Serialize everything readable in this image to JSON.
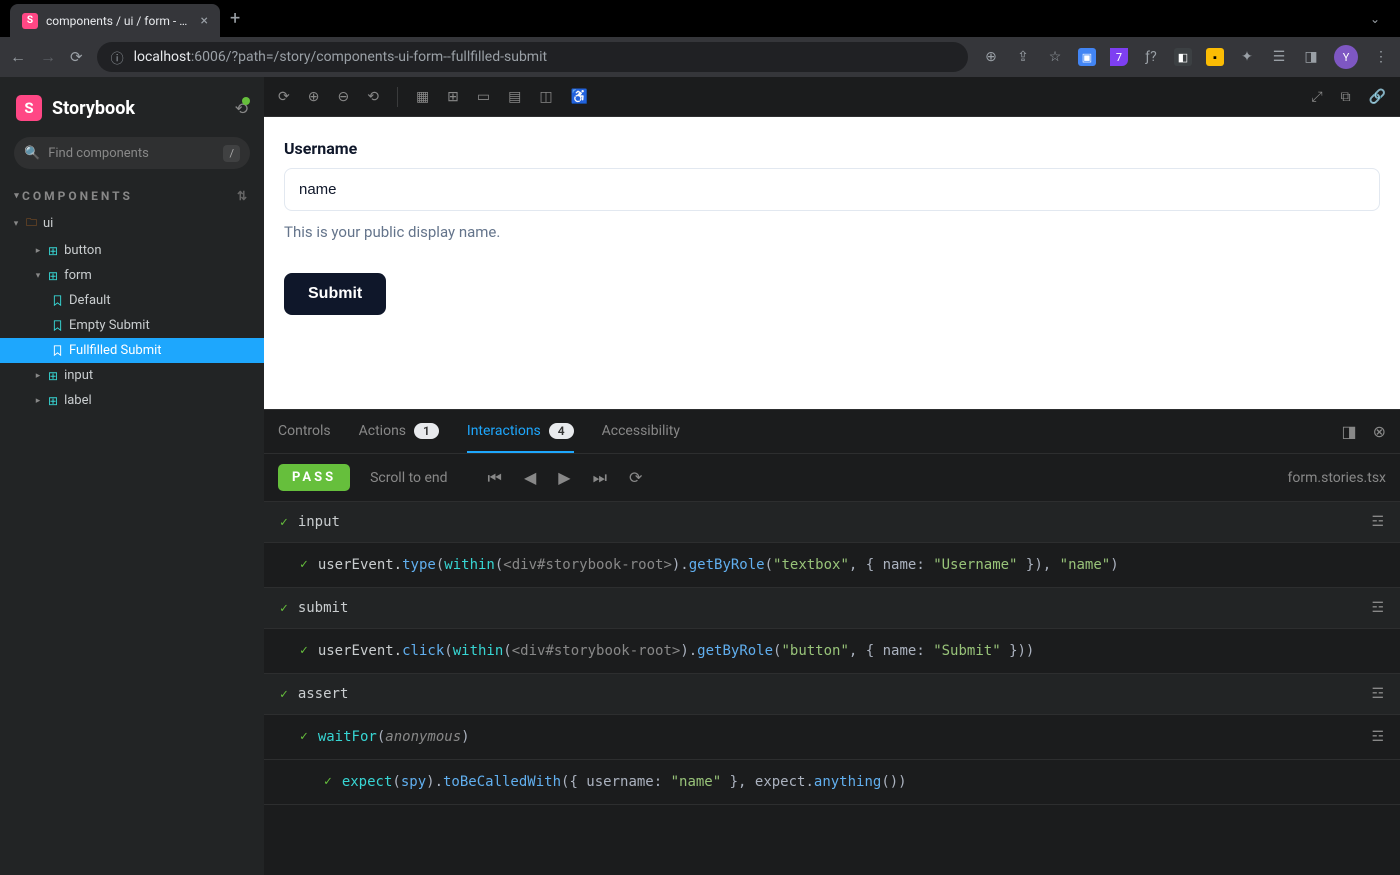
{
  "browser": {
    "tab_title": "components / ui / form - Fullfil",
    "url_prefix": "localhost",
    "url_rest": ":6006/?path=/story/components-ui-form--fullfilled-submit",
    "profile_initial": "Y",
    "ext_badge_number": "7"
  },
  "sidebar": {
    "brand": "Storybook",
    "search_placeholder": "Find components",
    "search_key": "/",
    "section": "COMPONENTS",
    "tree": {
      "root": "ui",
      "button": "button",
      "form": "form",
      "stories": {
        "default": "Default",
        "empty": "Empty Submit",
        "fullfilled": "Fullfilled Submit"
      },
      "input": "input",
      "label": "label"
    }
  },
  "preview": {
    "label": "Username",
    "input_value": "name",
    "help": "This is your public display name.",
    "submit": "Submit"
  },
  "addons": {
    "tabs": {
      "controls": "Controls",
      "actions": "Actions",
      "actions_count": "1",
      "interactions": "Interactions",
      "interactions_count": "4",
      "accessibility": "Accessibility"
    },
    "status": "PASS",
    "scroll": "Scroll to end",
    "file": "form.stories.tsx",
    "groups": {
      "input": "input",
      "submit": "submit",
      "assert": "assert"
    },
    "steps": {
      "s1": {
        "p1": "userEvent.",
        "p2": "type",
        "p3": "(",
        "p4": "within",
        "p5": "(",
        "p6": "<div#storybook-root>",
        "p7": ").",
        "p8": "getByRole",
        "p9": "(",
        "p10": "\"textbox\"",
        "p11": ", { name: ",
        "p12": "\"Username\"",
        "p13": " }), ",
        "p14": "\"name\"",
        "p15": ")"
      },
      "s2": {
        "p1": "userEvent.",
        "p2": "click",
        "p3": "(",
        "p4": "within",
        "p5": "(",
        "p6": "<div#storybook-root>",
        "p7": ").",
        "p8": "getByRole",
        "p9": "(",
        "p10": "\"button\"",
        "p11": ", { name: ",
        "p12": "\"Submit\"",
        "p13": " }))"
      },
      "s3": {
        "p1": "waitFor",
        "p2": "(",
        "p3": "anonymous",
        "p4": ")"
      },
      "s4": {
        "p1": "expect",
        "p2": "(",
        "p3": "spy",
        "p4": ").",
        "p5": "toBeCalledWith",
        "p6": "({ username: ",
        "p7": "\"name\"",
        "p8": " }, expect.",
        "p9": "anything",
        "p10": "())"
      }
    }
  }
}
